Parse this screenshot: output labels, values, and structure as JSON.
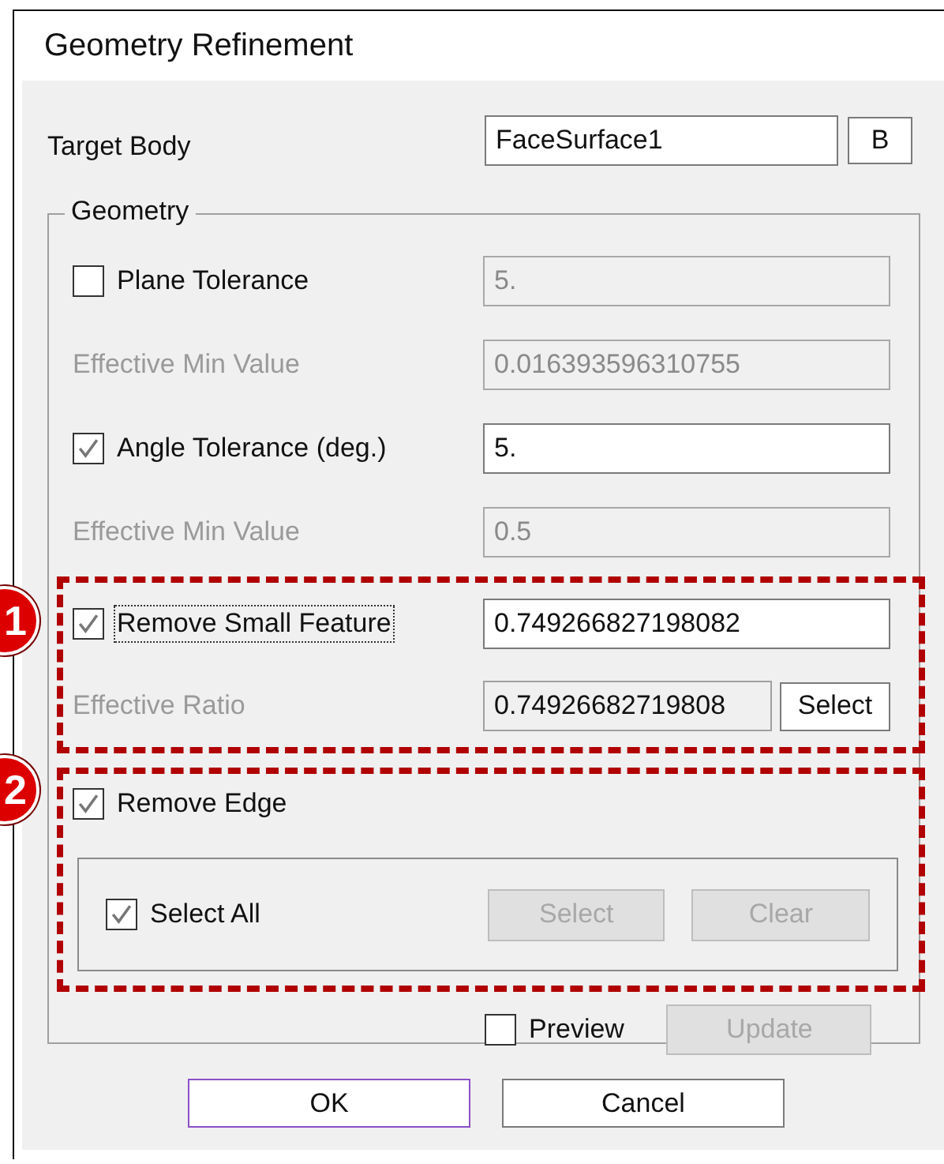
{
  "window": {
    "title": "Geometry Refinement"
  },
  "target_body": {
    "label": "Target Body",
    "value": "FaceSurface1",
    "button": "B"
  },
  "geometry": {
    "legend": "Geometry",
    "rows": [
      {
        "kind": "check",
        "label": "Plane Tolerance",
        "checked": false,
        "value": "5."
      },
      {
        "kind": "readout",
        "label": "Effective Min Value",
        "value": "0.016393596310755"
      },
      {
        "kind": "check",
        "label": "Angle Tolerance (deg.)",
        "checked": true,
        "value": "5."
      },
      {
        "kind": "readout",
        "label": "Effective Min Value",
        "value": "0.5"
      }
    ],
    "small_feature": {
      "callout": "1",
      "label": "Remove Small Feature",
      "checked": true,
      "focused": true,
      "value": "0.749266827198082",
      "ratio_label": "Effective Ratio",
      "ratio_value": "0.74926682719808",
      "ratio_button": "Select"
    },
    "remove_edge": {
      "callout": "2",
      "label": "Remove Edge",
      "checked": true,
      "select_all": {
        "label": "Select All",
        "checked": true
      },
      "buttons": [
        {
          "label": "Select",
          "disabled": true
        },
        {
          "label": "Clear",
          "disabled": true
        }
      ]
    },
    "preview": {
      "label": "Preview",
      "checked": false
    },
    "update_button": {
      "label": "Update",
      "disabled": true
    }
  },
  "buttons": [
    {
      "label": "OK",
      "default": true
    },
    {
      "label": "Cancel",
      "default": false
    }
  ]
}
